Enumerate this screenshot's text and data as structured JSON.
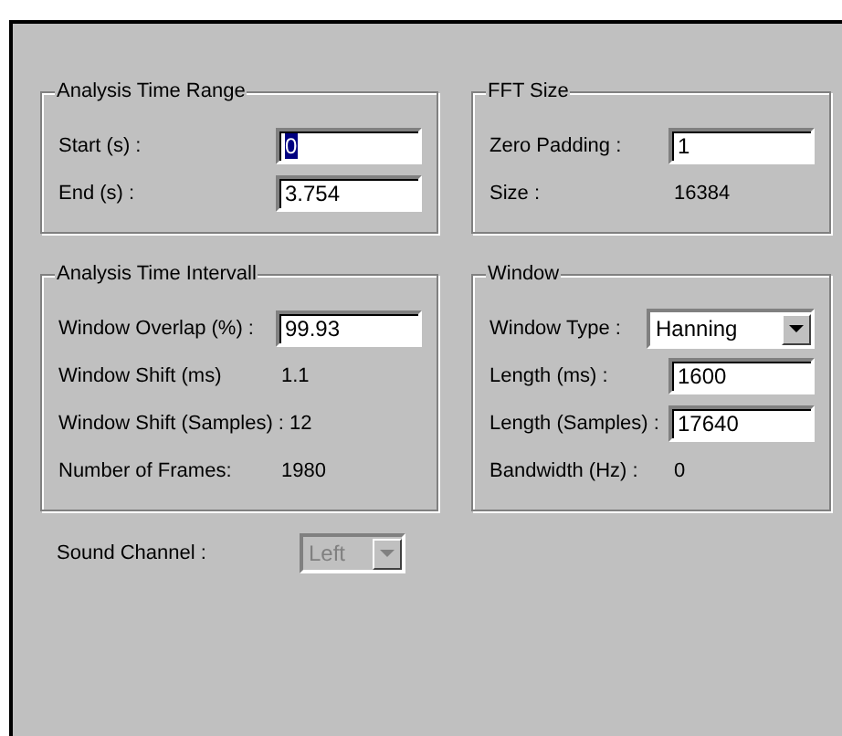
{
  "groups": [
    {
      "title": "Analysis Time Range",
      "rows": [
        {
          "kind": "input",
          "label": "Start (s) :",
          "value": "0",
          "text_selected": true
        },
        {
          "kind": "input",
          "label": "End (s) :",
          "value": "3.754",
          "text_selected": false
        }
      ]
    },
    {
      "title": "FFT Size",
      "rows": [
        {
          "kind": "input",
          "label": "Zero Padding :",
          "value": "1",
          "text_selected": false
        },
        {
          "kind": "value",
          "label": "Size :",
          "value": "16384"
        }
      ]
    },
    {
      "title": "Analysis Time Intervall",
      "rows": [
        {
          "kind": "input",
          "label": "Window Overlap (%) :",
          "value": "99.93",
          "text_selected": false
        },
        {
          "kind": "value",
          "label": "Window Shift (ms)",
          "value": "1.1"
        },
        {
          "kind": "value",
          "label": "Window Shift (Samples) :",
          "value": "12"
        },
        {
          "kind": "value",
          "label": "Number of Frames:",
          "value": "1980"
        }
      ]
    },
    {
      "title": "Window",
      "rows": [
        {
          "kind": "select",
          "label": "Window Type :",
          "value": "Hanning",
          "disabled": false
        },
        {
          "kind": "input",
          "label": "Length (ms) :",
          "value": "1600",
          "text_selected": false
        },
        {
          "kind": "input",
          "label": "Length (Samples) :",
          "value": "17640",
          "text_selected": false
        },
        {
          "kind": "value",
          "label": "Bandwidth (Hz) :",
          "value": "0"
        }
      ]
    }
  ],
  "sound_channel": {
    "label": "Sound Channel :",
    "value": "Left",
    "disabled": true
  }
}
